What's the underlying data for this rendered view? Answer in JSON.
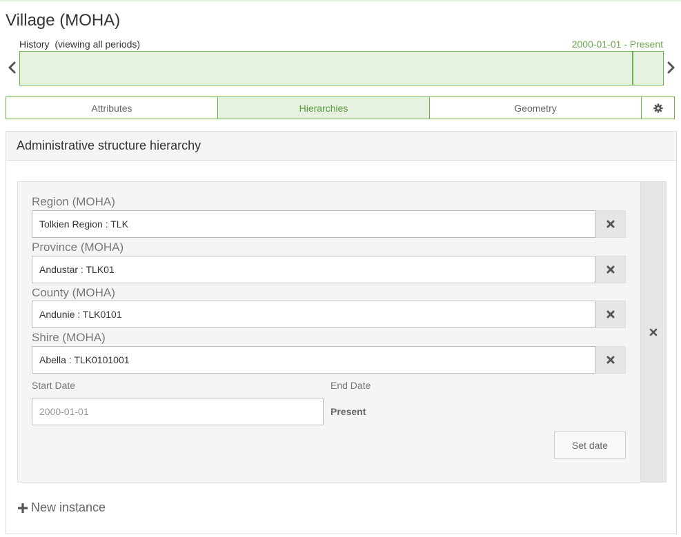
{
  "page": {
    "title": "Village (MOHA)"
  },
  "history": {
    "label": "History  (viewing all periods)",
    "range": "2000-01-01 - Present",
    "prev_icon": "chevron-left-icon",
    "next_icon": "chevron-right-icon"
  },
  "tabs": [
    {
      "label": "Attributes",
      "active": false
    },
    {
      "label": "Hierarchies",
      "active": true
    },
    {
      "label": "Geometry",
      "active": false
    },
    {
      "label": "",
      "icon": "gear-icon"
    }
  ],
  "panel": {
    "title": "Administrative structure hierarchy",
    "fields": [
      {
        "label": "Region (MOHA)",
        "value": "Tolkien Region : TLK"
      },
      {
        "label": "Province (MOHA)",
        "value": "Andustar : TLK01"
      },
      {
        "label": "County (MOHA)",
        "value": "Andunie : TLK0101"
      },
      {
        "label": "Shire (MOHA)",
        "value": "Abella : TLK0101001"
      }
    ],
    "start_date": {
      "label": "Start Date",
      "placeholder": "2000-01-01"
    },
    "end_date": {
      "label": "End Date",
      "value": "Present"
    },
    "set_date_label": "Set date",
    "new_instance_label": "New instance"
  },
  "colors": {
    "accent": "#6ab04c",
    "accent_bg": "#e6f2df",
    "accent_text": "#5a9b3f"
  }
}
